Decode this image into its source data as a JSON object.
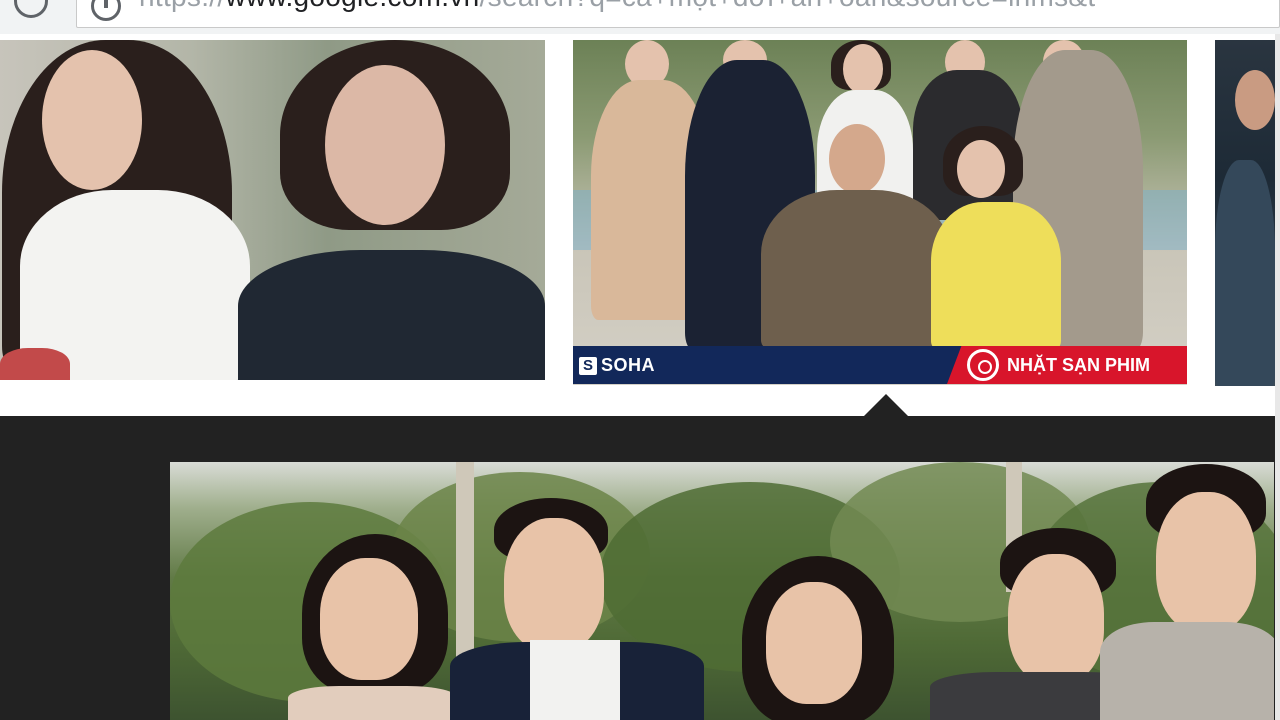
{
  "browser": {
    "url_prefix": "https://",
    "url_domain": "www.google.com.vn",
    "url_rest": "/search?q=cả+một+đời+ân+oán&source=lnms&t"
  },
  "results": {
    "thumbnails": [
      {
        "name": "thumb-left"
      },
      {
        "name": "thumb-selected"
      },
      {
        "name": "thumb-right"
      }
    ],
    "selected_banner": {
      "logo_letter": "S",
      "logo_text": "SOHA",
      "tag_label": "NHẶT SẠN PHIM"
    }
  },
  "preview": {},
  "colors": {
    "banner_blue": "#12285a",
    "banner_red": "#d8152b",
    "preview_bg": "#222222"
  },
  "icons": [
    "back-icon",
    "info-icon",
    "film-reel-icon",
    "soha-logo-icon"
  ]
}
